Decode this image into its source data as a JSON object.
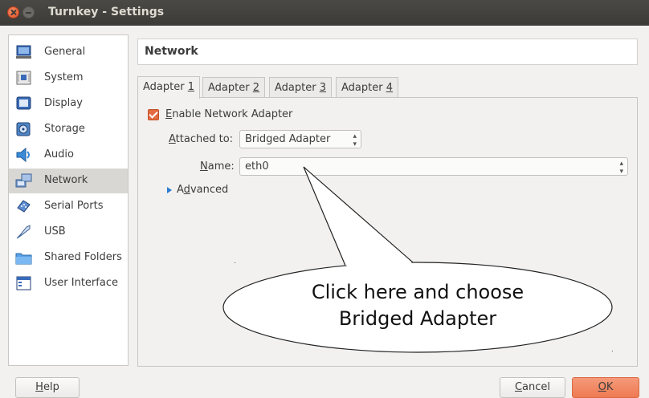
{
  "window": {
    "title": "Turnkey - Settings"
  },
  "sidebar": {
    "items": [
      {
        "label": "General",
        "icon": "general-icon"
      },
      {
        "label": "System",
        "icon": "system-icon"
      },
      {
        "label": "Display",
        "icon": "display-icon"
      },
      {
        "label": "Storage",
        "icon": "storage-icon"
      },
      {
        "label": "Audio",
        "icon": "audio-icon"
      },
      {
        "label": "Network",
        "icon": "network-icon",
        "selected": true
      },
      {
        "label": "Serial Ports",
        "icon": "serial-ports-icon"
      },
      {
        "label": "USB",
        "icon": "usb-icon"
      },
      {
        "label": "Shared Folders",
        "icon": "shared-folders-icon"
      },
      {
        "label": "User Interface",
        "icon": "user-interface-icon"
      }
    ]
  },
  "main": {
    "section_title": "Network",
    "tabs": [
      {
        "pre": "Adapter ",
        "key": "1",
        "active": true
      },
      {
        "pre": "Adapter ",
        "key": "2"
      },
      {
        "pre": "Adapter ",
        "key": "3"
      },
      {
        "pre": "Adapter ",
        "key": "4"
      }
    ],
    "enable_checkbox": {
      "key": "E",
      "rest": "nable Network Adapter",
      "checked": true
    },
    "attached_to": {
      "key": "A",
      "rest": "ttached to:",
      "value": "Bridged Adapter"
    },
    "name": {
      "key": "N",
      "rest": "ame:",
      "value": "eth0"
    },
    "advanced": {
      "pre": "A",
      "key": "d",
      "rest": "vanced"
    }
  },
  "callout": {
    "line1": "Click here and choose",
    "line2": "Bridged Adapter"
  },
  "buttons": {
    "help": {
      "key": "H",
      "rest": "elp"
    },
    "cancel": {
      "key": "C",
      "rest": "ancel"
    },
    "ok": {
      "key": "O",
      "rest": "K"
    }
  },
  "colors": {
    "accent": "#e46c41",
    "titlebar": "#3c3b37",
    "selected_item": "#d8d7d3"
  }
}
